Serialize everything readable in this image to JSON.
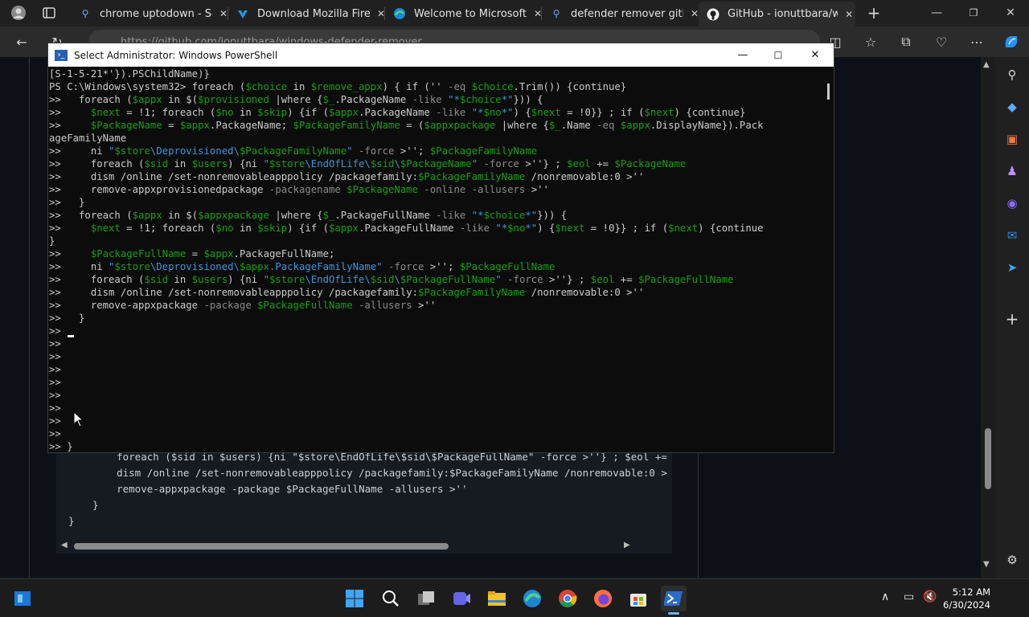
{
  "browser": {
    "tabs": [
      {
        "title": "chrome uptodown - Sea",
        "icon": "search-icon",
        "active": false
      },
      {
        "title": "Download Mozilla Firefo",
        "icon": "uptodown-icon",
        "active": false
      },
      {
        "title": "Welcome to Microsoft E",
        "icon": "edge-icon",
        "active": false
      },
      {
        "title": "defender remover githu",
        "icon": "search-icon",
        "active": false
      },
      {
        "title": "GitHub - ionuttbara/win",
        "icon": "github-icon",
        "active": true
      }
    ],
    "url": "https://github.com/ionuttbara/windows-defender-remover",
    "new_tab": "+"
  },
  "page": {
    "code_lines": [
      "    foreach ($sid in $users) {ni \"$store\\EndOfLife\\$sid\\$PackageFullName\" -force >''} ; $eol +=",
      "    dism /online /set-nonremovableapppolicy /packagefamily:$PackageFamilyName /nonremovable:0 >",
      "    remove-appxpackage -package $PackageFullName -allusers >''",
      "  }",
      "}"
    ]
  },
  "powershell": {
    "title": "Select Administrator: Windows PowerShell",
    "lines": [
      "[S-1-5-21*'}).PSChildName)}",
      "PS C:\\Windows\\system32> foreach ($choice in $remove_appx) { if ('' -eq $choice.Trim()) {continue}",
      ">>   foreach ($appx in $($provisioned |where {$_.PackageName -like \"*$choice*\"})) {",
      ">>     $next = !1; foreach ($no in $skip) {if ($appx.PackageName -like \"*$no*\") {$next = !0}} ; if ($next) {continue}",
      ">>     $PackageName = $appx.PackageName; $PackageFamilyName = ($appxpackage |where {$_.Name -eq $appx.DisplayName}).Pack",
      "ageFamilyName",
      ">>     ni \"$store\\Deprovisioned\\$PackageFamilyName\" -force >''; $PackageFamilyName",
      ">>     foreach ($sid in $users) {ni \"$store\\EndOfLife\\$sid\\$PackageName\" -force >''} ; $eol += $PackageName",
      ">>     dism /online /set-nonremovableapppolicy /packagefamily:$PackageFamilyName /nonremovable:0 >''",
      ">>     remove-appxprovisionedpackage -packagename $PackageName -online -allusers >''",
      ">>   }",
      ">>   foreach ($appx in $($appxpackage |where {$_.PackageFullName -like \"*$choice*\"})) {",
      ">>     $next = !1; foreach ($no in $skip) {if ($appx.PackageFullName -like \"*$no*\") {$next = !0}} ; if ($next) {continue",
      "}",
      ">>     $PackageFullName = $appx.PackageFullName;",
      ">>     ni \"$store\\Deprovisioned\\$appx.PackageFamilyName\" -force >''; $PackageFullName",
      ">>     foreach ($sid in $users) {ni \"$store\\EndOfLife\\$sid\\$PackageFullName\" -force >''} ; $eol += $PackageFullName",
      ">>     dism /online /set-nonremovableapppolicy /packagefamily:$PackageFamilyName /nonremovable:0 >''",
      ">>     remove-appxpackage -package $PackageFullName -allusers >''",
      ">>   }",
      ">>",
      ">>",
      ">>",
      ">>",
      ">>",
      ">>",
      ">>",
      ">>",
      ">>",
      ">> }"
    ]
  },
  "taskbar": {
    "clock_time": "5:12 AM",
    "clock_date": "6/30/2024",
    "apps": [
      "windows-start-icon",
      "search-icon",
      "task-view-icon",
      "teams-icon",
      "file-explorer-icon",
      "edge-icon",
      "chrome-icon",
      "firefox-icon",
      "store-icon",
      "powershell-icon"
    ]
  },
  "colors": {
    "accent_blue": "#3b78ff",
    "variable_green": "#13a10e",
    "string_cyan": "#3a96dd",
    "terminal_bg": "#0c0c0c"
  }
}
